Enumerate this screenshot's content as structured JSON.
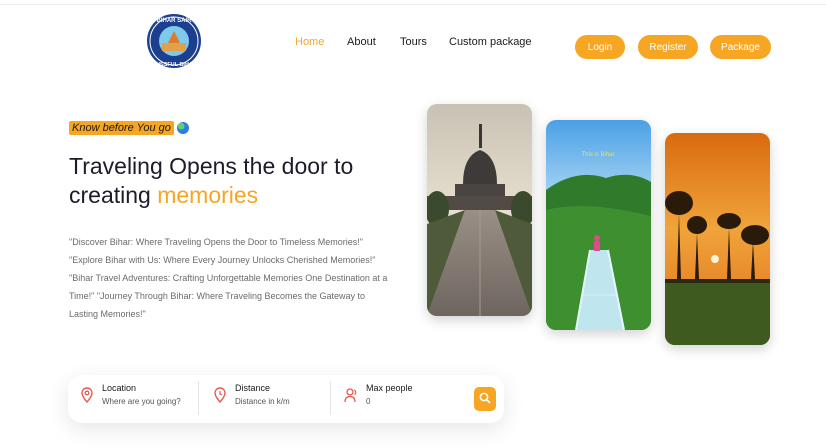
{
  "logo": {
    "text_top": "BIHAR SAIR",
    "text_bottom": "BLISSFUL BIHAR"
  },
  "nav": {
    "items": [
      {
        "label": "Home",
        "active": true
      },
      {
        "label": "About",
        "active": false
      },
      {
        "label": "Tours",
        "active": false
      },
      {
        "label": "Custom package",
        "active": false
      }
    ]
  },
  "buttons": {
    "login": "Login",
    "register": "Register",
    "package": "Package"
  },
  "hero": {
    "kicker": "Know before You go",
    "kicker_icon": "globe-icon",
    "headline_line1": "Traveling Opens the door to",
    "headline_prefix": "creating ",
    "headline_accent": "memories",
    "description": "\"Discover Bihar: Where Traveling Opens the Door to Timeless Memories!\" \"Explore Bihar with Us: Where Every Journey Unlocks Cherished Memories!\" \"Bihar Travel Adventures: Crafting Unforgettable Memories One Destination at a Time!\" \"Journey Through Bihar: Where Traveling Becomes the Gateway to Lasting Memories!\""
  },
  "cards": [
    {
      "subject": "stupa-photo"
    },
    {
      "subject": "glass-bridge-photo",
      "caption": "This is Bihar"
    },
    {
      "subject": "sunset-photo"
    }
  ],
  "search": {
    "location": {
      "label": "Location",
      "value": "Where are you going?",
      "icon": "location-pin-icon"
    },
    "distance": {
      "label": "Distance",
      "value": "Distance in k/m",
      "icon": "distance-pin-icon"
    },
    "people": {
      "label": "Max people",
      "value": "0",
      "icon": "people-icon"
    },
    "button_icon": "search-icon"
  },
  "colors": {
    "accent": "#f6a623",
    "text": "#1c1c2a",
    "muted": "#6b6b6b"
  }
}
